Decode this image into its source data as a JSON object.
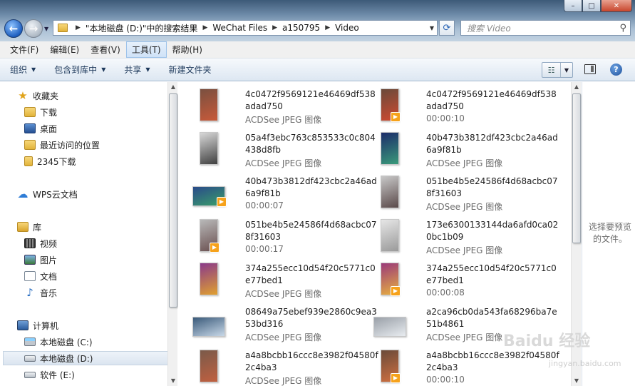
{
  "window": {
    "minimize": "–",
    "maximize": "□",
    "close": "✕"
  },
  "address": {
    "crumbs": [
      "\"本地磁盘 (D:)\"中的搜索结果",
      "WeChat Files",
      "a150795",
      "Video"
    ],
    "search_placeholder": "搜索 Video"
  },
  "menu": [
    "文件(F)",
    "编辑(E)",
    "查看(V)",
    "工具(T)",
    "帮助(H)"
  ],
  "toolbar": {
    "organize": "组织",
    "include_library": "包含到库中",
    "share": "共享",
    "new_folder": "新建文件夹"
  },
  "nav": {
    "favorites": "收藏夹",
    "downloads": "下载",
    "desktop": "桌面",
    "recent": "最近访问的位置",
    "dl2345": "2345下载",
    "wps": "WPS云文档",
    "library": "库",
    "videos": "视频",
    "pictures": "图片",
    "documents": "文档",
    "music": "音乐",
    "computer": "计算机",
    "drive_c": "本地磁盘 (C:)",
    "drive_d": "本地磁盘 (D:)",
    "drive_e": "软件 (E:)"
  },
  "files": [
    {
      "name": "4c0472f9569121e46469df538adad750",
      "meta": "ACDSee JPEG 图像",
      "video": false,
      "thumb": [
        "#7a5040",
        "#c85a3a"
      ]
    },
    {
      "name": "4c0472f9569121e46469df538adad750",
      "meta": "00:00:10",
      "video": true,
      "thumb": [
        "#6a4a3a",
        "#d04a30"
      ]
    },
    {
      "name": "05a4f3ebc763c853533c0c804438d8fb",
      "meta": "ACDSee JPEG 图像",
      "video": false,
      "thumb": [
        "#d8d8d8",
        "#404040"
      ]
    },
    {
      "name": "40b473b3812df423cbc2a46ad6a9f81b",
      "meta": "ACDSee JPEG 图像",
      "video": false,
      "thumb": [
        "#1c2c6a",
        "#3a9a7a"
      ]
    },
    {
      "name": "40b473b3812df423cbc2a46ad6a9f81b",
      "meta": "00:00:07",
      "video": true,
      "thumb": [
        "#2a4a8a",
        "#3aa06a"
      ]
    },
    {
      "name": "051be4b5e24586f4d68acbc078f31603",
      "meta": "ACDSee JPEG 图像",
      "video": false,
      "thumb": [
        "#c8c8c8",
        "#5a4a4a"
      ]
    },
    {
      "name": "051be4b5e24586f4d68acbc078f31603",
      "meta": "00:00:17",
      "video": true,
      "thumb": [
        "#b8b8b8",
        "#6a5050"
      ]
    },
    {
      "name": "173e6300133144da6afd0ca020bc1b09",
      "meta": "ACDSee JPEG 图像",
      "video": false,
      "thumb": [
        "#e6e6e6",
        "#9a9a9a"
      ]
    },
    {
      "name": "374a255ecc10d54f20c5771c0e77bed1",
      "meta": "ACDSee JPEG 图像",
      "video": false,
      "thumb": [
        "#8a3a8a",
        "#e0a030"
      ]
    },
    {
      "name": "374a255ecc10d54f20c5771c0e77bed1",
      "meta": "00:00:08",
      "video": true,
      "thumb": [
        "#9a3a7a",
        "#e8b040"
      ]
    },
    {
      "name": "08649a75ebef939e2860c9ea353bd316",
      "meta": "ACDSee JPEG 图像",
      "video": false,
      "thumb": [
        "#3a5a7a",
        "#c8d8e8"
      ]
    },
    {
      "name": "a2ca96cb0da543fa68296ba7e51b4861",
      "meta": "ACDSee JPEG 图像",
      "video": false,
      "thumb": [
        "#9aa0a8",
        "#e8ecf0"
      ]
    },
    {
      "name": "a4a8bcbb16ccc8e3982f04580f2c4ba3",
      "meta": "ACDSee JPEG 图像",
      "video": false,
      "thumb": [
        "#7a5a4a",
        "#c06040"
      ]
    },
    {
      "name": "a4a8bcbb16ccc8e3982f04580f2c4ba3",
      "meta": "00:00:10",
      "video": true,
      "thumb": [
        "#6a4a3a",
        "#d07040"
      ]
    }
  ],
  "preview_pane": {
    "text": "选择要预览的文件。"
  },
  "watermark": {
    "text": "Baidu 经验",
    "sub": "jingyan.baidu.com"
  }
}
